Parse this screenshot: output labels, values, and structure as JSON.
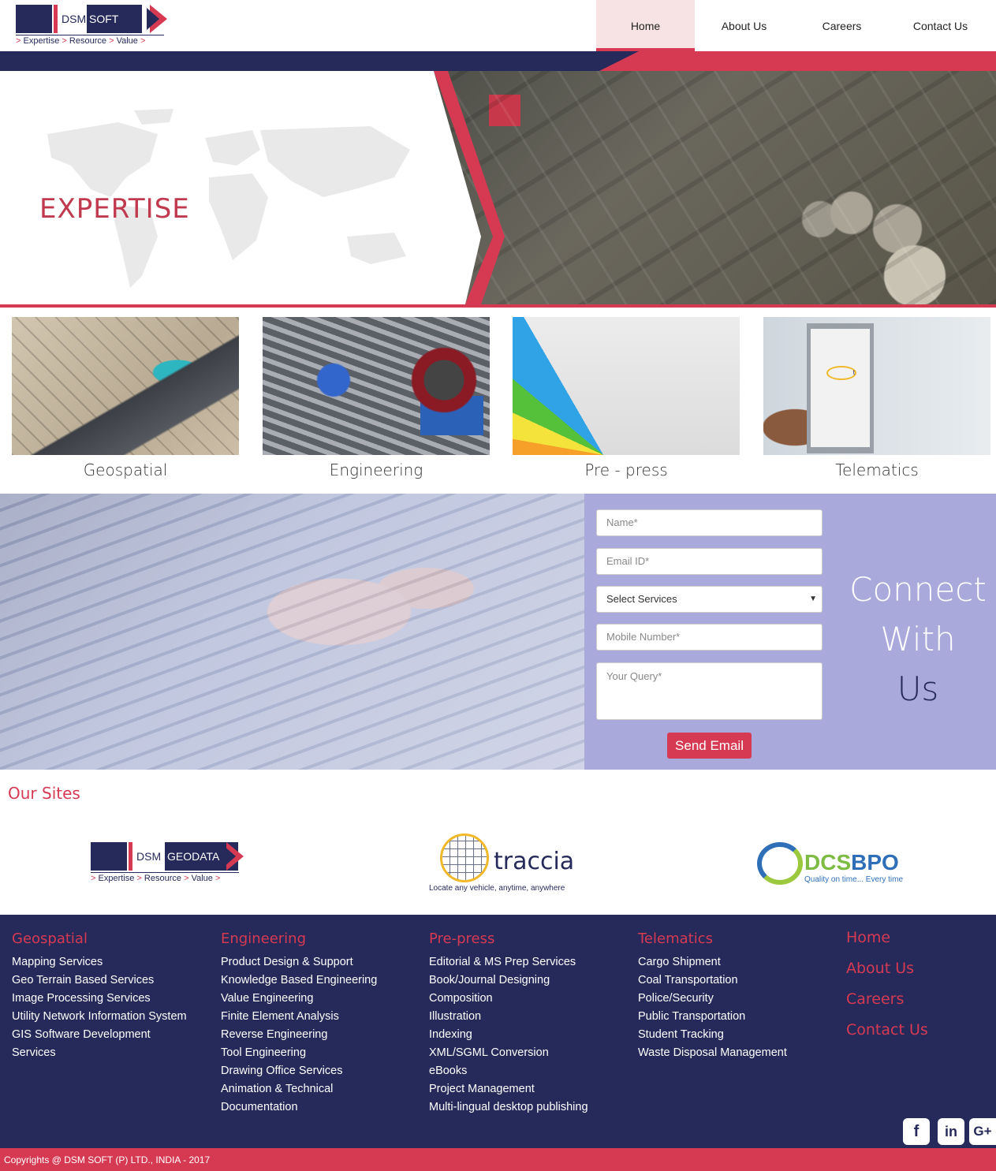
{
  "header": {
    "logo": {
      "word1": "DSM",
      "word2": "SOFT",
      "tagline": [
        "Expertise",
        "Resource",
        "Value"
      ],
      "separator": ">"
    },
    "nav": [
      "Home",
      "About Us",
      "Careers",
      "Contact Us"
    ],
    "active_nav": "Home"
  },
  "hero": {
    "title": "EXPERTISE"
  },
  "expertise": [
    {
      "label": "Geospatial",
      "image": "aerial-city-photo"
    },
    {
      "label": "Engineering",
      "image": "car-engine-photo"
    },
    {
      "label": "Pre - press",
      "image": "color-swatch-fan-photo"
    },
    {
      "label": "Telematics",
      "image": "phone-tracking-app-photo"
    }
  ],
  "connect": {
    "title": [
      "Connect",
      "With",
      "Us"
    ],
    "form": {
      "name_placeholder": "Name*",
      "email_placeholder": "Email ID*",
      "service_selected": "Select Services",
      "mobile_placeholder": "Mobile Number*",
      "query_placeholder": "Your Query*",
      "submit_label": "Send Email"
    }
  },
  "sites": {
    "title": "Our Sites",
    "geodata": {
      "word1": "DSM",
      "word2": "GEODATA",
      "tagline": [
        "Expertise",
        "Resource",
        "Value"
      ],
      "separator": ">"
    },
    "traccia": {
      "word": "raccia",
      "initial": "t",
      "tagline": "Locate any vehicle, anytime, anywhere"
    },
    "dcs": {
      "word1": "DCS",
      "word2": "BPO",
      "tagline": "Quality on time... Every time"
    }
  },
  "footer": {
    "columns": [
      {
        "heading": "Geospatial",
        "items": [
          "Mapping Services",
          "Geo Terrain Based Services",
          "Image Processing Services",
          "Utility Network Information System",
          "GIS Software Development",
          "Services"
        ]
      },
      {
        "heading": "Engineering",
        "items": [
          "Product Design & Support",
          "Knowledge Based Engineering",
          "Value Engineering",
          "Finite Element Analysis",
          "Reverse Engineering",
          "Tool Engineering",
          "Drawing Office Services",
          "Animation & Technical",
          "Documentation"
        ]
      },
      {
        "heading": "Pre-press",
        "items": [
          "Editorial & MS Prep Services",
          "Book/Journal Designing",
          "Composition",
          "Illustration",
          "Indexing",
          "XML/SGML Conversion",
          "eBooks",
          "Project Management",
          "Multi-lingual desktop publishing"
        ]
      },
      {
        "heading": "Telematics",
        "items": [
          "Cargo Shipment",
          "Coal Transportation",
          "Police/Security",
          "Public Transportation",
          "Student Tracking",
          "Waste Disposal Management"
        ]
      }
    ],
    "nav": [
      "Home",
      "About Us",
      "Careers",
      "Contact Us"
    ],
    "social": [
      {
        "icon": "facebook-icon",
        "glyph": "f"
      },
      {
        "icon": "linkedin-icon",
        "glyph": "in"
      },
      {
        "icon": "google-plus-icon",
        "glyph": "G+"
      }
    ],
    "copyright": "Copyrights @ DSM SOFT (P) LTD., INDIA - 2017"
  },
  "colors": {
    "navy": "#262a5a",
    "accent_red": "#d63a53",
    "form_panel": "#a9a9dc"
  }
}
